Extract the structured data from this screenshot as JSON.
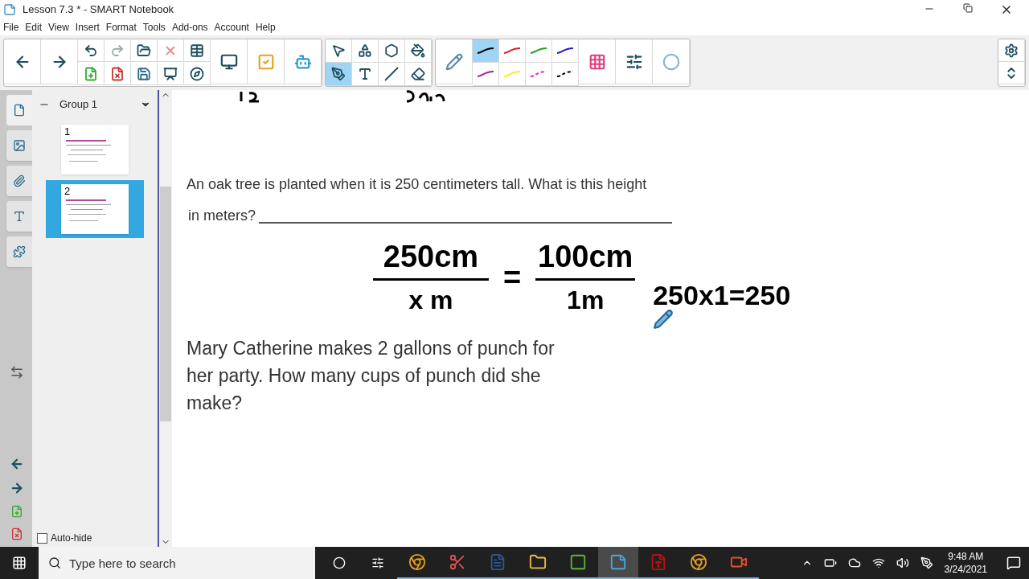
{
  "window": {
    "title": "Lesson 7.3 * - SMART Notebook"
  },
  "menu": [
    "File",
    "Edit",
    "View",
    "Insert",
    "Format",
    "Tools",
    "Add-ons",
    "Account",
    "Help"
  ],
  "tool_buttons": [
    {
      "kind": "select",
      "selected": false
    },
    {
      "kind": "shapes",
      "selected": false
    },
    {
      "kind": "polygon",
      "selected": false
    },
    {
      "kind": "fill",
      "selected": false
    },
    {
      "kind": "pens",
      "selected": true
    },
    {
      "kind": "text",
      "selected": false
    },
    {
      "kind": "line",
      "selected": false
    },
    {
      "kind": "eraser",
      "selected": false
    }
  ],
  "pen_styles": [
    {
      "color": "#000000",
      "dashed": false,
      "selected": true
    },
    {
      "color": "#e02020",
      "dashed": false,
      "selected": false
    },
    {
      "color": "#20a020",
      "dashed": false,
      "selected": false
    },
    {
      "color": "#2020c0",
      "dashed": false,
      "selected": false
    },
    {
      "color": "#a020a0",
      "dashed": false,
      "selected": false
    },
    {
      "color": "#f0f020",
      "dashed": false,
      "selected": false
    },
    {
      "color": "#f020c0",
      "dashed": true,
      "selected": false
    },
    {
      "color": "#000000",
      "dashed": true,
      "selected": false
    }
  ],
  "sidebar": {
    "tabs": [
      {
        "kind": "page",
        "selected": true
      },
      {
        "kind": "gallery",
        "selected": false
      },
      {
        "kind": "attachment",
        "selected": false
      },
      {
        "kind": "properties",
        "selected": false
      },
      {
        "kind": "addon",
        "selected": false
      }
    ],
    "group": "Group 1",
    "pages": [
      {
        "number": "1",
        "selected": false
      },
      {
        "number": "2",
        "selected": true
      }
    ],
    "auto_hide": {
      "label": "Auto-hide",
      "checked": false
    }
  },
  "page": {
    "question_1": "An oak tree is planted when it is 250 centimeters tall. What is this height",
    "question_1_line2": "in meters?",
    "ink": {
      "fraction_left_top": "250cm",
      "fraction_left_bottom": "x  m",
      "equals": "=",
      "fraction_right_top": "100cm",
      "fraction_right_bottom": "1m",
      "work": "250x1=250"
    },
    "question_2": "Mary Catherine makes 2 gallons of punch for her party. How many cups of punch did she make?"
  },
  "taskbar": {
    "search_placeholder": "Type here to search",
    "apps": [
      {
        "kind": "chrome",
        "active": false
      },
      {
        "kind": "snip",
        "active": false
      },
      {
        "kind": "word",
        "active": false
      },
      {
        "kind": "folder",
        "active": false
      },
      {
        "kind": "camtasia",
        "active": false
      },
      {
        "kind": "notebook",
        "active": true
      },
      {
        "kind": "pdf",
        "active": false
      },
      {
        "kind": "chrome",
        "active": false
      },
      {
        "kind": "recorder",
        "active": false
      }
    ],
    "time": "9:48 AM",
    "date": "3/24/2021"
  }
}
